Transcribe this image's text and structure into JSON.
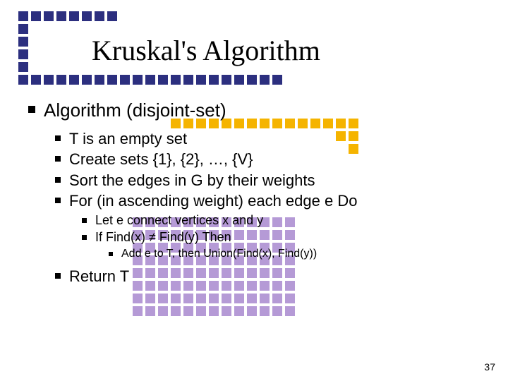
{
  "title": "Kruskal's Algorithm",
  "slide_number": "37",
  "bullets": {
    "l1_0": "Algorithm (disjoint-set)",
    "l2_0": "T is an empty set",
    "l2_1": "Create sets {1}, {2}, …, {V}",
    "l2_2": "Sort the edges in G by their weights",
    "l2_3": "For (in ascending weight) each edge e Do",
    "l3_0": "Let e connect vertices x and y",
    "l3_1": "If Find(x) ≠ Find(y) Then",
    "l4_0": "Add e to T, then Union(Find(x), Find(y))",
    "l2_4": "Return T"
  }
}
